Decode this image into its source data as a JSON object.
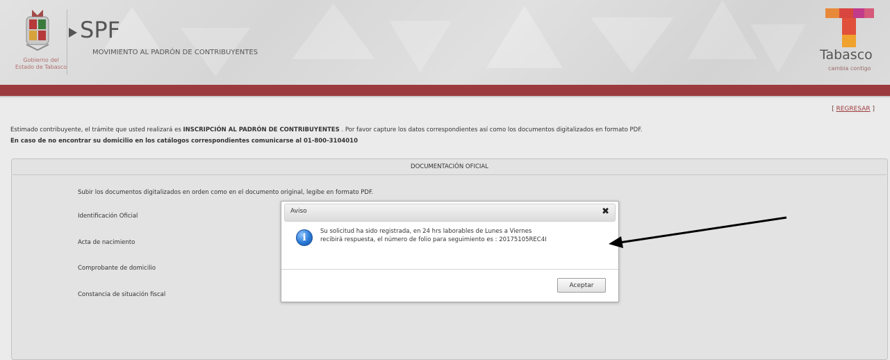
{
  "header": {
    "gov_line1": "Gobierno del",
    "gov_line2": "Estado de Tabasco",
    "app_name": "SPF",
    "subtitle": "MOVIMIENTO AL PADRÓN DE CONTRIBUYENTES",
    "brand_name": "Tabasco",
    "brand_tagline": "cambia contigo",
    "bar_color": "#9c3b3f"
  },
  "nav": {
    "back_open": "[ ",
    "back_link": "REGRESAR",
    "back_close": " ]"
  },
  "intro": {
    "line1_prefix": "Estimado contribuyente, el trámite que usted realizará es ",
    "line1_bold": "INSCRIPCIÓN AL PADRÓN DE CONTRIBUYENTES",
    "line1_suffix": " . Por favor capture los datos correspondientes así como los documentos digitalizados en formato PDF.",
    "line2": "En caso de no encontrar su domicilio en los catálogos correspondientes comunicarse al 01-800-3104010"
  },
  "panel": {
    "title": "DOCUMENTACIÓN OFICIAL",
    "hint": "Subir los documentos digitalizados en orden como en el documento original, legibe en formato PDF.",
    "documents": [
      "Identificación Oficial",
      "Acta de nacimiento",
      "Comprobante de domicilio",
      "Constancia de situación fiscal"
    ]
  },
  "dialog": {
    "title": "Aviso",
    "close_symbol": "✖",
    "icon": "info-icon",
    "message_line1": "Su solicitud ha sido registrada, en 24 hrs laborables de Lunes a Viernes",
    "message_line2": "recibirá respuesta, el número de folio para seguimiento es : 20175105REC4I",
    "accept_label": "Aceptar"
  }
}
